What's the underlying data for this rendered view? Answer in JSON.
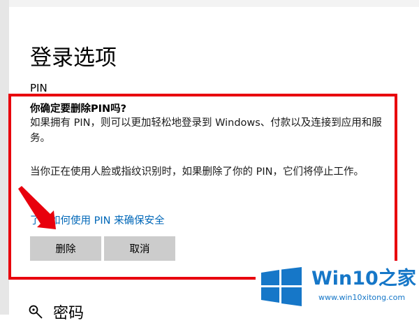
{
  "page": {
    "title": "登录选项",
    "section_label": "PIN"
  },
  "dialog": {
    "title": "你确定要删除PIN吗?",
    "paragraph1": "如果拥有 PIN，则可以更加轻松地登录到 Windows、付款以及连接到应用和服务。",
    "paragraph2": "当你正在使用人脸或指纹识别时，如果删除了你的 PIN，它们将停止工作。",
    "link": "了解如何使用 PIN 来确保安全",
    "delete_label": "删除",
    "cancel_label": "取消"
  },
  "next_section": {
    "label": "密码",
    "icon": "key-icon"
  },
  "watermark": {
    "brand": "Win10之家",
    "url": "www.win10xitong.com"
  },
  "colors": {
    "highlight": "#e8000d",
    "link": "#0067b8",
    "button": "#cccccc",
    "watermark": "#1677c8"
  }
}
